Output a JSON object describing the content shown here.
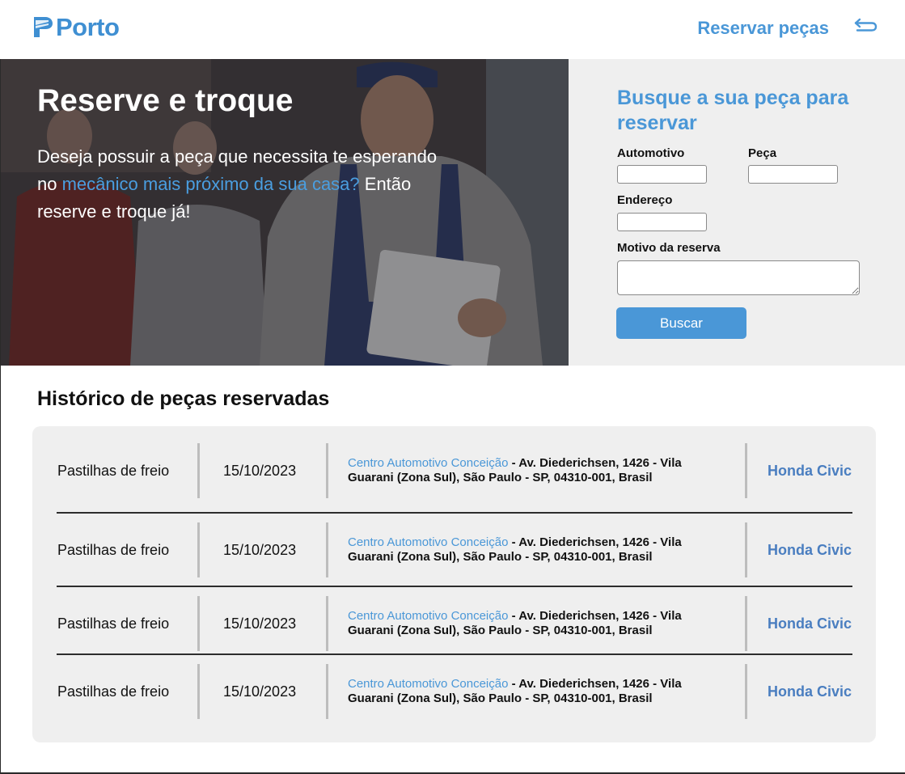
{
  "header": {
    "logo_text": "Porto",
    "nav_link": "Reservar peças",
    "logout_icon": "logout-arrow-icon"
  },
  "hero": {
    "title": "Reserve e troque",
    "text_part1": "Deseja possuir a peça que necessita te esperando no ",
    "text_highlight": "mecânico mais próximo da sua casa?",
    "text_part2": " Então reserve e troque já!",
    "highlight_color": "#4a9ee0"
  },
  "search": {
    "title": "Busque a sua peça para reservar",
    "label_automotivo": "Automotivo",
    "label_peca": "Peça",
    "label_endereco": "Endereço",
    "label_motivo": "Motivo da reserva",
    "value_automotivo": "",
    "value_peca": "",
    "value_endereco": "",
    "value_motivo": "",
    "button_label": "Buscar"
  },
  "history": {
    "title": "Histórico de peças reservadas",
    "rows": [
      {
        "part": "Pastilhas de freio",
        "date": "15/10/2023",
        "center": "Centro Automotivo Conceição",
        "address": " - Av. Diederichsen, 1426 - Vila Guarani (Zona Sul), São Paulo - SP, 04310-001, Brasil",
        "car": "Honda Civic"
      },
      {
        "part": "Pastilhas de freio",
        "date": "15/10/2023",
        "center": "Centro Automotivo Conceição",
        "address": " - Av. Diederichsen, 1426 - Vila Guarani (Zona Sul), São Paulo - SP, 04310-001, Brasil",
        "car": "Honda Civic"
      },
      {
        "part": "Pastilhas de freio",
        "date": "15/10/2023",
        "center": "Centro Automotivo Conceição",
        "address": " - Av. Diederichsen, 1426 - Vila Guarani (Zona Sul), São Paulo - SP, 04310-001, Brasil",
        "car": "Honda Civic"
      },
      {
        "part": "Pastilhas de freio",
        "date": "15/10/2023",
        "center": "Centro Automotivo Conceição",
        "address": " - Av. Diederichsen, 1426 - Vila Guarani (Zona Sul), São Paulo - SP, 04310-001, Brasil",
        "car": "Honda Civic"
      }
    ]
  },
  "colors": {
    "brand_blue": "#4a97d7",
    "car_blue": "#4a7ec0",
    "panel_gray": "#efefef"
  }
}
